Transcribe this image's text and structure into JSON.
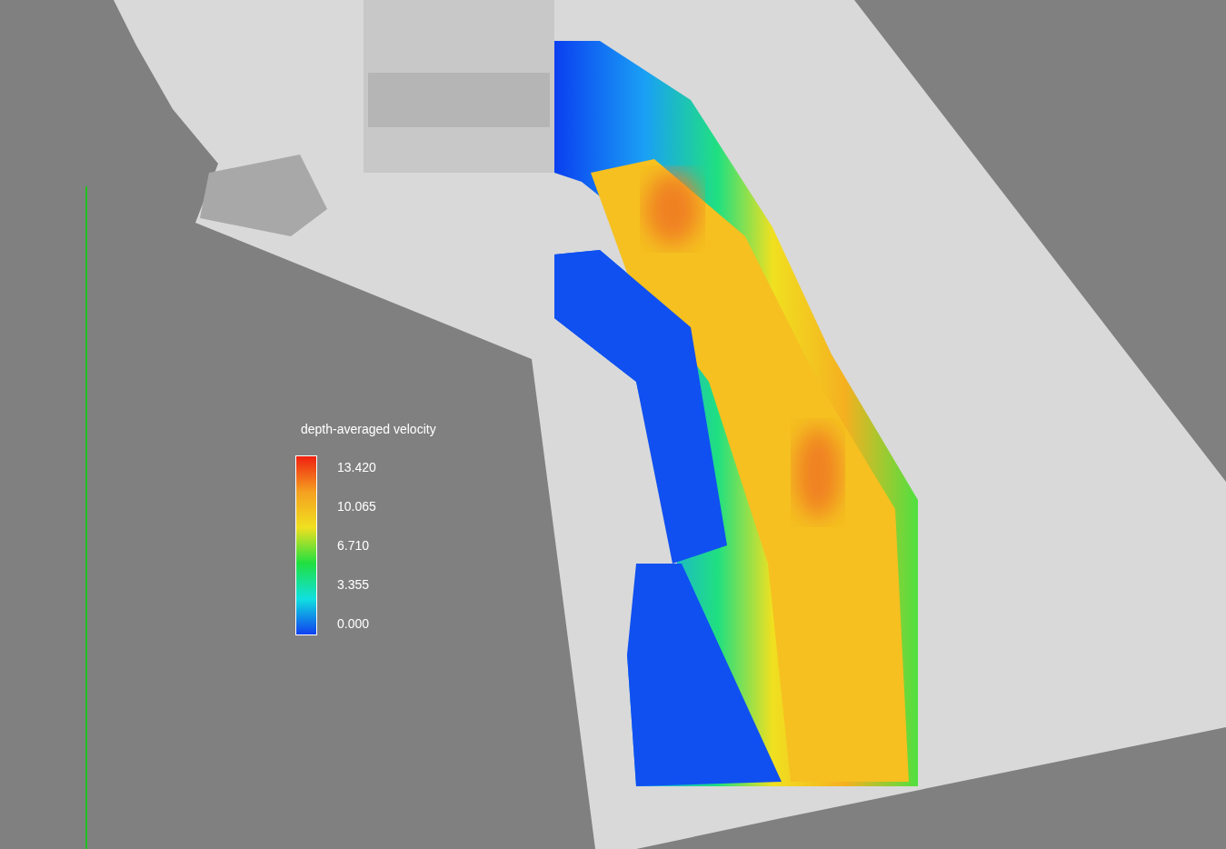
{
  "legend": {
    "title": "depth-averaged velocity",
    "labels": [
      "13.420",
      "10.065",
      "6.710",
      "3.355",
      "0.000"
    ]
  }
}
